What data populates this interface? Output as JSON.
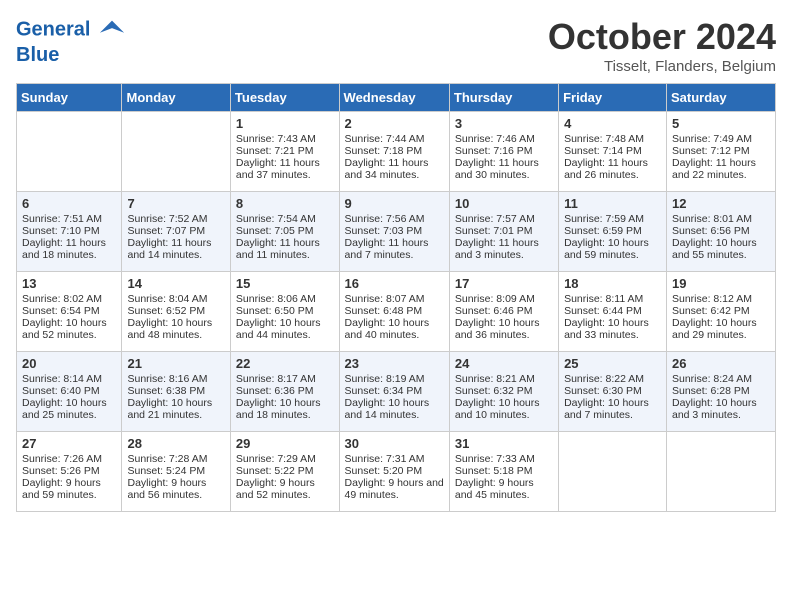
{
  "header": {
    "logo_line1": "General",
    "logo_line2": "Blue",
    "month": "October 2024",
    "location": "Tisselt, Flanders, Belgium"
  },
  "weekdays": [
    "Sunday",
    "Monday",
    "Tuesday",
    "Wednesday",
    "Thursday",
    "Friday",
    "Saturday"
  ],
  "weeks": [
    [
      {
        "day": "",
        "sunrise": "",
        "sunset": "",
        "daylight": ""
      },
      {
        "day": "",
        "sunrise": "",
        "sunset": "",
        "daylight": ""
      },
      {
        "day": "1",
        "sunrise": "Sunrise: 7:43 AM",
        "sunset": "Sunset: 7:21 PM",
        "daylight": "Daylight: 11 hours and 37 minutes."
      },
      {
        "day": "2",
        "sunrise": "Sunrise: 7:44 AM",
        "sunset": "Sunset: 7:18 PM",
        "daylight": "Daylight: 11 hours and 34 minutes."
      },
      {
        "day": "3",
        "sunrise": "Sunrise: 7:46 AM",
        "sunset": "Sunset: 7:16 PM",
        "daylight": "Daylight: 11 hours and 30 minutes."
      },
      {
        "day": "4",
        "sunrise": "Sunrise: 7:48 AM",
        "sunset": "Sunset: 7:14 PM",
        "daylight": "Daylight: 11 hours and 26 minutes."
      },
      {
        "day": "5",
        "sunrise": "Sunrise: 7:49 AM",
        "sunset": "Sunset: 7:12 PM",
        "daylight": "Daylight: 11 hours and 22 minutes."
      }
    ],
    [
      {
        "day": "6",
        "sunrise": "Sunrise: 7:51 AM",
        "sunset": "Sunset: 7:10 PM",
        "daylight": "Daylight: 11 hours and 18 minutes."
      },
      {
        "day": "7",
        "sunrise": "Sunrise: 7:52 AM",
        "sunset": "Sunset: 7:07 PM",
        "daylight": "Daylight: 11 hours and 14 minutes."
      },
      {
        "day": "8",
        "sunrise": "Sunrise: 7:54 AM",
        "sunset": "Sunset: 7:05 PM",
        "daylight": "Daylight: 11 hours and 11 minutes."
      },
      {
        "day": "9",
        "sunrise": "Sunrise: 7:56 AM",
        "sunset": "Sunset: 7:03 PM",
        "daylight": "Daylight: 11 hours and 7 minutes."
      },
      {
        "day": "10",
        "sunrise": "Sunrise: 7:57 AM",
        "sunset": "Sunset: 7:01 PM",
        "daylight": "Daylight: 11 hours and 3 minutes."
      },
      {
        "day": "11",
        "sunrise": "Sunrise: 7:59 AM",
        "sunset": "Sunset: 6:59 PM",
        "daylight": "Daylight: 10 hours and 59 minutes."
      },
      {
        "day": "12",
        "sunrise": "Sunrise: 8:01 AM",
        "sunset": "Sunset: 6:56 PM",
        "daylight": "Daylight: 10 hours and 55 minutes."
      }
    ],
    [
      {
        "day": "13",
        "sunrise": "Sunrise: 8:02 AM",
        "sunset": "Sunset: 6:54 PM",
        "daylight": "Daylight: 10 hours and 52 minutes."
      },
      {
        "day": "14",
        "sunrise": "Sunrise: 8:04 AM",
        "sunset": "Sunset: 6:52 PM",
        "daylight": "Daylight: 10 hours and 48 minutes."
      },
      {
        "day": "15",
        "sunrise": "Sunrise: 8:06 AM",
        "sunset": "Sunset: 6:50 PM",
        "daylight": "Daylight: 10 hours and 44 minutes."
      },
      {
        "day": "16",
        "sunrise": "Sunrise: 8:07 AM",
        "sunset": "Sunset: 6:48 PM",
        "daylight": "Daylight: 10 hours and 40 minutes."
      },
      {
        "day": "17",
        "sunrise": "Sunrise: 8:09 AM",
        "sunset": "Sunset: 6:46 PM",
        "daylight": "Daylight: 10 hours and 36 minutes."
      },
      {
        "day": "18",
        "sunrise": "Sunrise: 8:11 AM",
        "sunset": "Sunset: 6:44 PM",
        "daylight": "Daylight: 10 hours and 33 minutes."
      },
      {
        "day": "19",
        "sunrise": "Sunrise: 8:12 AM",
        "sunset": "Sunset: 6:42 PM",
        "daylight": "Daylight: 10 hours and 29 minutes."
      }
    ],
    [
      {
        "day": "20",
        "sunrise": "Sunrise: 8:14 AM",
        "sunset": "Sunset: 6:40 PM",
        "daylight": "Daylight: 10 hours and 25 minutes."
      },
      {
        "day": "21",
        "sunrise": "Sunrise: 8:16 AM",
        "sunset": "Sunset: 6:38 PM",
        "daylight": "Daylight: 10 hours and 21 minutes."
      },
      {
        "day": "22",
        "sunrise": "Sunrise: 8:17 AM",
        "sunset": "Sunset: 6:36 PM",
        "daylight": "Daylight: 10 hours and 18 minutes."
      },
      {
        "day": "23",
        "sunrise": "Sunrise: 8:19 AM",
        "sunset": "Sunset: 6:34 PM",
        "daylight": "Daylight: 10 hours and 14 minutes."
      },
      {
        "day": "24",
        "sunrise": "Sunrise: 8:21 AM",
        "sunset": "Sunset: 6:32 PM",
        "daylight": "Daylight: 10 hours and 10 minutes."
      },
      {
        "day": "25",
        "sunrise": "Sunrise: 8:22 AM",
        "sunset": "Sunset: 6:30 PM",
        "daylight": "Daylight: 10 hours and 7 minutes."
      },
      {
        "day": "26",
        "sunrise": "Sunrise: 8:24 AM",
        "sunset": "Sunset: 6:28 PM",
        "daylight": "Daylight: 10 hours and 3 minutes."
      }
    ],
    [
      {
        "day": "27",
        "sunrise": "Sunrise: 7:26 AM",
        "sunset": "Sunset: 5:26 PM",
        "daylight": "Daylight: 9 hours and 59 minutes."
      },
      {
        "day": "28",
        "sunrise": "Sunrise: 7:28 AM",
        "sunset": "Sunset: 5:24 PM",
        "daylight": "Daylight: 9 hours and 56 minutes."
      },
      {
        "day": "29",
        "sunrise": "Sunrise: 7:29 AM",
        "sunset": "Sunset: 5:22 PM",
        "daylight": "Daylight: 9 hours and 52 minutes."
      },
      {
        "day": "30",
        "sunrise": "Sunrise: 7:31 AM",
        "sunset": "Sunset: 5:20 PM",
        "daylight": "Daylight: 9 hours and 49 minutes."
      },
      {
        "day": "31",
        "sunrise": "Sunrise: 7:33 AM",
        "sunset": "Sunset: 5:18 PM",
        "daylight": "Daylight: 9 hours and 45 minutes."
      },
      {
        "day": "",
        "sunrise": "",
        "sunset": "",
        "daylight": ""
      },
      {
        "day": "",
        "sunrise": "",
        "sunset": "",
        "daylight": ""
      }
    ]
  ]
}
